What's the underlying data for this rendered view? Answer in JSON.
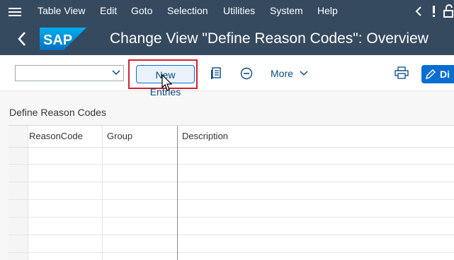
{
  "menubar": {
    "items": [
      "Table View",
      "Edit",
      "Goto",
      "Selection",
      "Utilities",
      "System",
      "Help"
    ]
  },
  "titlebar": {
    "logo_text": "SAP",
    "title": "Change View \"Define Reason Codes\": Overview"
  },
  "toolbar": {
    "select_value": "",
    "new_entries_label": "New Entries",
    "more_label": "More",
    "display_label": "Di"
  },
  "table": {
    "section_title": "Define Reason Codes",
    "columns": [
      "ReasonCode",
      "Group",
      "Description"
    ],
    "rows": 6
  },
  "colors": {
    "shell": "#354a5f",
    "accent": "#0a6ed1",
    "highlight": "#d0222e"
  },
  "icons": [
    "hamburger-icon",
    "back-icon",
    "help-icon",
    "unlock-icon",
    "chevron-down-icon",
    "details-icon",
    "minus-circle-icon",
    "print-icon",
    "pencil-icon",
    "cursor-icon"
  ]
}
